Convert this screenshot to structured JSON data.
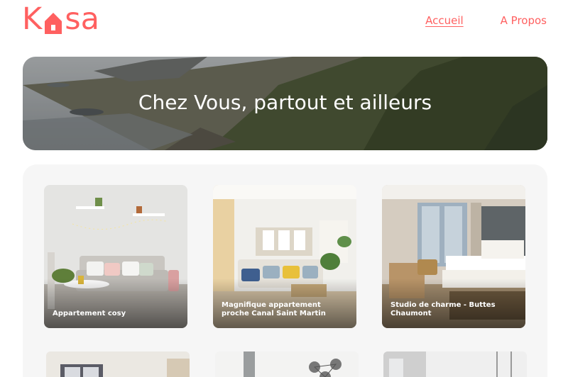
{
  "brand": {
    "logo_left": "K",
    "logo_right": "sa",
    "logo_text": "Kasa",
    "accent_color": "#ff6060"
  },
  "nav": {
    "items": [
      {
        "label": "Accueil",
        "active": true
      },
      {
        "label": "A Propos",
        "active": false
      }
    ]
  },
  "banner": {
    "title": "Chez Vous, partout et ailleurs"
  },
  "gallery": {
    "cards": [
      {
        "title": "Appartement cosy"
      },
      {
        "title": "Magnifique appartement proche Canal Saint Martin"
      },
      {
        "title": "Studio de charme - Buttes Chaumont"
      },
      {
        "title": ""
      },
      {
        "title": ""
      },
      {
        "title": ""
      }
    ]
  }
}
